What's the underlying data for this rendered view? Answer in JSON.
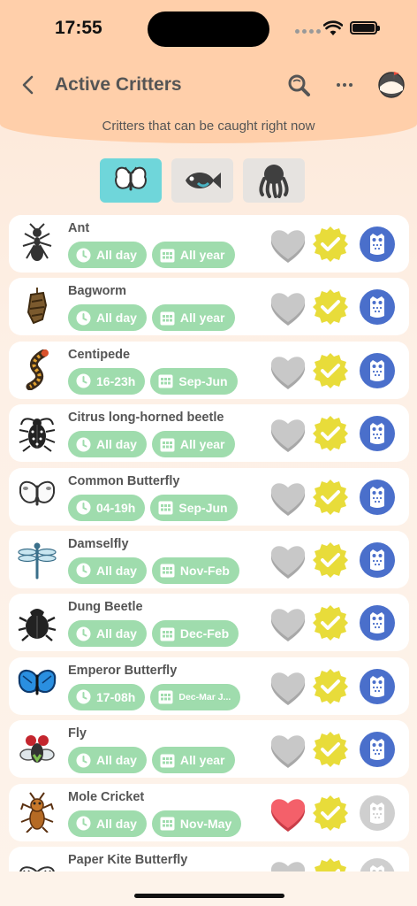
{
  "status_bar": {
    "time": "17:55"
  },
  "header": {
    "title": "Active Critters",
    "subtitle": "Critters that can be caught right now"
  },
  "tabs": [
    {
      "name": "insects",
      "icon": "butterfly-icon",
      "active": true
    },
    {
      "name": "fish",
      "icon": "fish-icon",
      "active": false
    },
    {
      "name": "sea-creatures",
      "icon": "octopus-icon",
      "active": false
    }
  ],
  "critters": [
    {
      "name": "Ant",
      "time": "All day",
      "months": "All year",
      "icon": "ant-icon",
      "favorite": false,
      "caught": true,
      "donated": true
    },
    {
      "name": "Bagworm",
      "time": "All day",
      "months": "All year",
      "icon": "bagworm-icon",
      "favorite": false,
      "caught": true,
      "donated": true
    },
    {
      "name": "Centipede",
      "time": "16-23h",
      "months": "Sep-Jun",
      "icon": "centipede-icon",
      "favorite": false,
      "caught": true,
      "donated": true
    },
    {
      "name": "Citrus long-horned beetle",
      "time": "All day",
      "months": "All year",
      "icon": "beetle-icon",
      "favorite": false,
      "caught": true,
      "donated": true
    },
    {
      "name": "Common Butterfly",
      "time": "04-19h",
      "months": "Sep-Jun",
      "icon": "butterfly-icon",
      "favorite": false,
      "caught": true,
      "donated": true
    },
    {
      "name": "Damselfly",
      "time": "All day",
      "months": "Nov-Feb",
      "icon": "damselfly-icon",
      "favorite": false,
      "caught": true,
      "donated": true
    },
    {
      "name": "Dung Beetle",
      "time": "All day",
      "months": "Dec-Feb",
      "icon": "dung-beetle-icon",
      "favorite": false,
      "caught": true,
      "donated": true
    },
    {
      "name": "Emperor Butterfly",
      "time": "17-08h",
      "months": "Dec-Mar J...",
      "icon": "emperor-butterfly-icon",
      "favorite": false,
      "caught": true,
      "donated": true,
      "small_months": true
    },
    {
      "name": "Fly",
      "time": "All day",
      "months": "All year",
      "icon": "fly-icon",
      "favorite": false,
      "caught": true,
      "donated": true
    },
    {
      "name": "Mole Cricket",
      "time": "All day",
      "months": "Nov-May",
      "icon": "mole-cricket-icon",
      "favorite": true,
      "caught": true,
      "donated": false
    },
    {
      "name": "Paper Kite Butterfly",
      "time": "",
      "months": "",
      "icon": "paper-kite-butterfly-icon",
      "favorite": false,
      "caught": true,
      "donated": false
    }
  ],
  "colors": {
    "header": "#ffcfaa",
    "tab_active": "#6fd6da",
    "chip": "#9fdcad",
    "check": "#e8dc3a",
    "owl_donated": "#4a6fcb",
    "owl_not": "#cfcfcf",
    "heart_off": "#c8c8c8",
    "heart_on": "#f4606a"
  }
}
